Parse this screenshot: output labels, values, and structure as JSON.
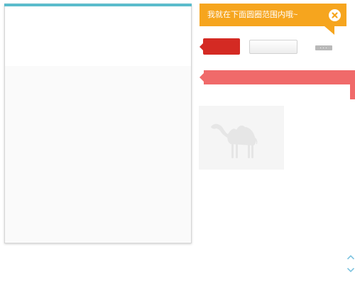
{
  "tooltip": {
    "text": "我就在下面圆圈范围内哦~",
    "close_icon": "close-icon"
  },
  "colors": {
    "card_accent": "#5bbccc",
    "tooltip_bg": "#f6a51e",
    "red_tag": "#d42a23",
    "salmon_bar": "#f06a6a",
    "scroll_arrow": "#7fc4e0"
  },
  "more_button": {
    "label": "···"
  },
  "placeholder": {
    "icon": "camel-icon"
  },
  "scroll": {
    "up_icon": "chevron-up-icon",
    "down_icon": "chevron-down-icon"
  }
}
